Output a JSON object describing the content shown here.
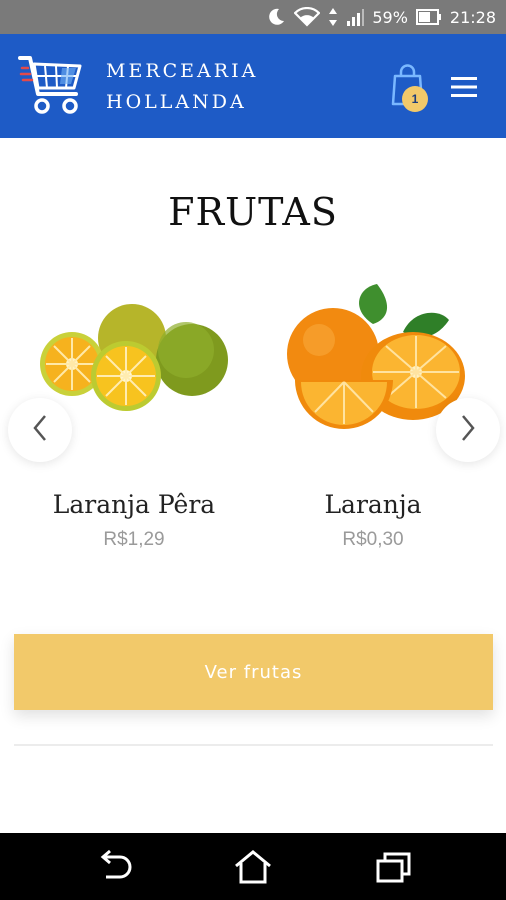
{
  "status_bar": {
    "battery_percent": "59%",
    "time": "21:28",
    "icons": [
      "moon-icon",
      "wifi-icon",
      "data-arrows-icon",
      "signal-icon",
      "battery-icon"
    ]
  },
  "header": {
    "brand_line1": "MERCEARIA",
    "brand_line2": "HOLLANDA",
    "cart_count": "1",
    "icons": [
      "shopping-cart-logo-icon",
      "shopping-bag-icon",
      "hamburger-menu-icon"
    ]
  },
  "section": {
    "title": "FRUTAS",
    "products": [
      {
        "name": "Laranja Pêra",
        "price": "R$1,29"
      },
      {
        "name": "Laranja",
        "price": "R$0,30"
      }
    ],
    "cta_label": "Ver frutas"
  },
  "colors": {
    "header_bg": "#1e5bc6",
    "accent": "#f2c96a",
    "status_bar_bg": "#7a7a7a",
    "nav_bar_bg": "#000000"
  }
}
